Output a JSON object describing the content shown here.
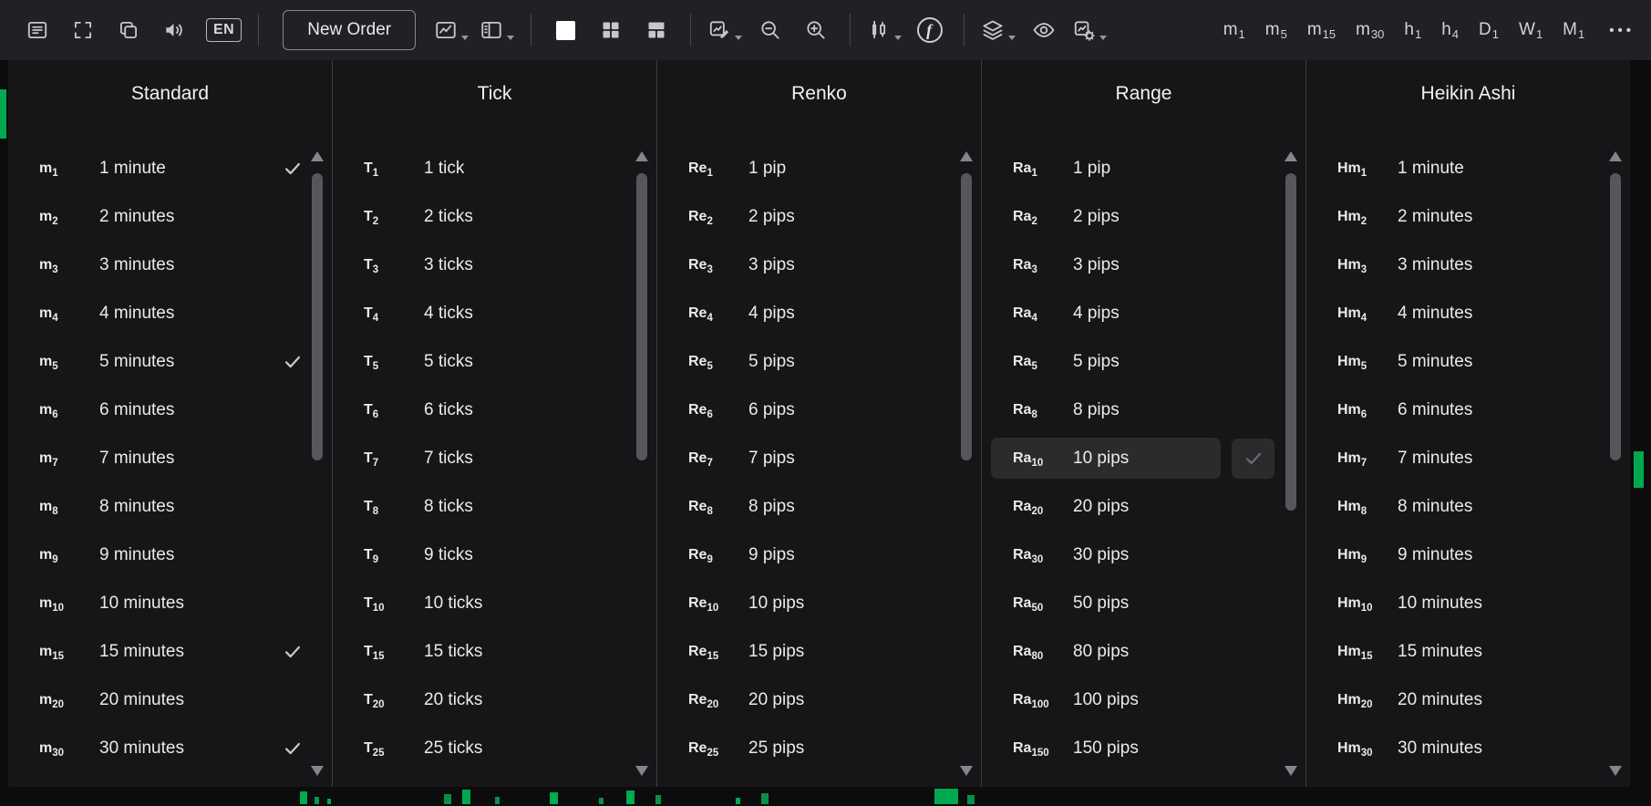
{
  "toolbar": {
    "icon_names": [
      "active-symbol-panel-icon",
      "fullscreen-icon",
      "duplicate-chart-icon",
      "sound-icon",
      "language-button",
      "new-order-button",
      "chart-display-icon",
      "chart-layout-icon",
      "single-chart-layout-icon",
      "grid-layout-icon",
      "split-layout-icon",
      "chart-edit-icon",
      "zoom-out-icon",
      "zoom-in-icon",
      "chart-type-candles-icon",
      "fx-symbol-icon",
      "layers-icon",
      "eye-icon",
      "chart-settings-icon",
      "more-button"
    ],
    "language_label": "EN",
    "new_order_label": "New Order",
    "fx_glyph": "f",
    "quick_timeframes": [
      {
        "prefix": "m",
        "sub": "1"
      },
      {
        "prefix": "m",
        "sub": "5"
      },
      {
        "prefix": "m",
        "sub": "15"
      },
      {
        "prefix": "m",
        "sub": "30"
      },
      {
        "prefix": "h",
        "sub": "1"
      },
      {
        "prefix": "h",
        "sub": "4"
      },
      {
        "prefix": "D",
        "sub": "1"
      },
      {
        "prefix": "W",
        "sub": "1"
      },
      {
        "prefix": "M",
        "sub": "1"
      }
    ],
    "more_label": "•••"
  },
  "panel": {
    "columns": [
      {
        "title": "Standard",
        "items": [
          {
            "prefix": "m",
            "sub": "1",
            "label": "1 minute",
            "checked": true
          },
          {
            "prefix": "m",
            "sub": "2",
            "label": "2 minutes"
          },
          {
            "prefix": "m",
            "sub": "3",
            "label": "3 minutes"
          },
          {
            "prefix": "m",
            "sub": "4",
            "label": "4 minutes"
          },
          {
            "prefix": "m",
            "sub": "5",
            "label": "5 minutes",
            "checked": true
          },
          {
            "prefix": "m",
            "sub": "6",
            "label": "6 minutes"
          },
          {
            "prefix": "m",
            "sub": "7",
            "label": "7 minutes"
          },
          {
            "prefix": "m",
            "sub": "8",
            "label": "8 minutes"
          },
          {
            "prefix": "m",
            "sub": "9",
            "label": "9 minutes"
          },
          {
            "prefix": "m",
            "sub": "10",
            "label": "10 minutes"
          },
          {
            "prefix": "m",
            "sub": "15",
            "label": "15 minutes",
            "checked": true
          },
          {
            "prefix": "m",
            "sub": "20",
            "label": "20 minutes"
          },
          {
            "prefix": "m",
            "sub": "30",
            "label": "30 minutes",
            "checked": true
          }
        ]
      },
      {
        "title": "Tick",
        "items": [
          {
            "prefix": "T",
            "sub": "1",
            "label": "1 tick"
          },
          {
            "prefix": "T",
            "sub": "2",
            "label": "2 ticks"
          },
          {
            "prefix": "T",
            "sub": "3",
            "label": "3 ticks"
          },
          {
            "prefix": "T",
            "sub": "4",
            "label": "4 ticks"
          },
          {
            "prefix": "T",
            "sub": "5",
            "label": "5 ticks"
          },
          {
            "prefix": "T",
            "sub": "6",
            "label": "6 ticks"
          },
          {
            "prefix": "T",
            "sub": "7",
            "label": "7 ticks"
          },
          {
            "prefix": "T",
            "sub": "8",
            "label": "8 ticks"
          },
          {
            "prefix": "T",
            "sub": "9",
            "label": "9 ticks"
          },
          {
            "prefix": "T",
            "sub": "10",
            "label": "10 ticks"
          },
          {
            "prefix": "T",
            "sub": "15",
            "label": "15 ticks"
          },
          {
            "prefix": "T",
            "sub": "20",
            "label": "20 ticks"
          },
          {
            "prefix": "T",
            "sub": "25",
            "label": "25 ticks"
          }
        ]
      },
      {
        "title": "Renko",
        "items": [
          {
            "prefix": "Re",
            "sub": "1",
            "label": "1 pip"
          },
          {
            "prefix": "Re",
            "sub": "2",
            "label": "2 pips"
          },
          {
            "prefix": "Re",
            "sub": "3",
            "label": "3 pips"
          },
          {
            "prefix": "Re",
            "sub": "4",
            "label": "4 pips"
          },
          {
            "prefix": "Re",
            "sub": "5",
            "label": "5 pips"
          },
          {
            "prefix": "Re",
            "sub": "6",
            "label": "6 pips"
          },
          {
            "prefix": "Re",
            "sub": "7",
            "label": "7 pips"
          },
          {
            "prefix": "Re",
            "sub": "8",
            "label": "8 pips"
          },
          {
            "prefix": "Re",
            "sub": "9",
            "label": "9 pips"
          },
          {
            "prefix": "Re",
            "sub": "10",
            "label": "10 pips"
          },
          {
            "prefix": "Re",
            "sub": "15",
            "label": "15 pips"
          },
          {
            "prefix": "Re",
            "sub": "20",
            "label": "20 pips"
          },
          {
            "prefix": "Re",
            "sub": "25",
            "label": "25 pips"
          }
        ]
      },
      {
        "title": "Range",
        "items": [
          {
            "prefix": "Ra",
            "sub": "1",
            "label": "1 pip"
          },
          {
            "prefix": "Ra",
            "sub": "2",
            "label": "2 pips"
          },
          {
            "prefix": "Ra",
            "sub": "3",
            "label": "3 pips"
          },
          {
            "prefix": "Ra",
            "sub": "4",
            "label": "4 pips"
          },
          {
            "prefix": "Ra",
            "sub": "5",
            "label": "5 pips"
          },
          {
            "prefix": "Ra",
            "sub": "8",
            "label": "8 pips"
          },
          {
            "prefix": "Ra",
            "sub": "10",
            "label": "10 pips",
            "selected": true
          },
          {
            "prefix": "Ra",
            "sub": "20",
            "label": "20 pips"
          },
          {
            "prefix": "Ra",
            "sub": "30",
            "label": "30 pips"
          },
          {
            "prefix": "Ra",
            "sub": "50",
            "label": "50 pips"
          },
          {
            "prefix": "Ra",
            "sub": "80",
            "label": "80 pips"
          },
          {
            "prefix": "Ra",
            "sub": "100",
            "label": "100 pips"
          },
          {
            "prefix": "Ra",
            "sub": "150",
            "label": "150 pips"
          }
        ]
      },
      {
        "title": "Heikin Ashi",
        "items": [
          {
            "prefix": "Hm",
            "sub": "1",
            "label": "1 minute"
          },
          {
            "prefix": "Hm",
            "sub": "2",
            "label": "2 minutes"
          },
          {
            "prefix": "Hm",
            "sub": "3",
            "label": "3 minutes"
          },
          {
            "prefix": "Hm",
            "sub": "4",
            "label": "4 minutes"
          },
          {
            "prefix": "Hm",
            "sub": "5",
            "label": "5 minutes"
          },
          {
            "prefix": "Hm",
            "sub": "6",
            "label": "6 minutes"
          },
          {
            "prefix": "Hm",
            "sub": "7",
            "label": "7 minutes"
          },
          {
            "prefix": "Hm",
            "sub": "8",
            "label": "8 minutes"
          },
          {
            "prefix": "Hm",
            "sub": "9",
            "label": "9 minutes"
          },
          {
            "prefix": "Hm",
            "sub": "10",
            "label": "10 minutes"
          },
          {
            "prefix": "Hm",
            "sub": "15",
            "label": "15 minutes"
          },
          {
            "prefix": "Hm",
            "sub": "20",
            "label": "20 minutes"
          },
          {
            "prefix": "Hm",
            "sub": "30",
            "label": "30 minutes"
          }
        ]
      }
    ]
  },
  "colors": {
    "accent_green": "#00a94f",
    "toolbar_bg": "#1f2124",
    "panel_bg": "#161618",
    "row_highlight": "#2b2b2e",
    "text_primary": "#ebebec"
  }
}
